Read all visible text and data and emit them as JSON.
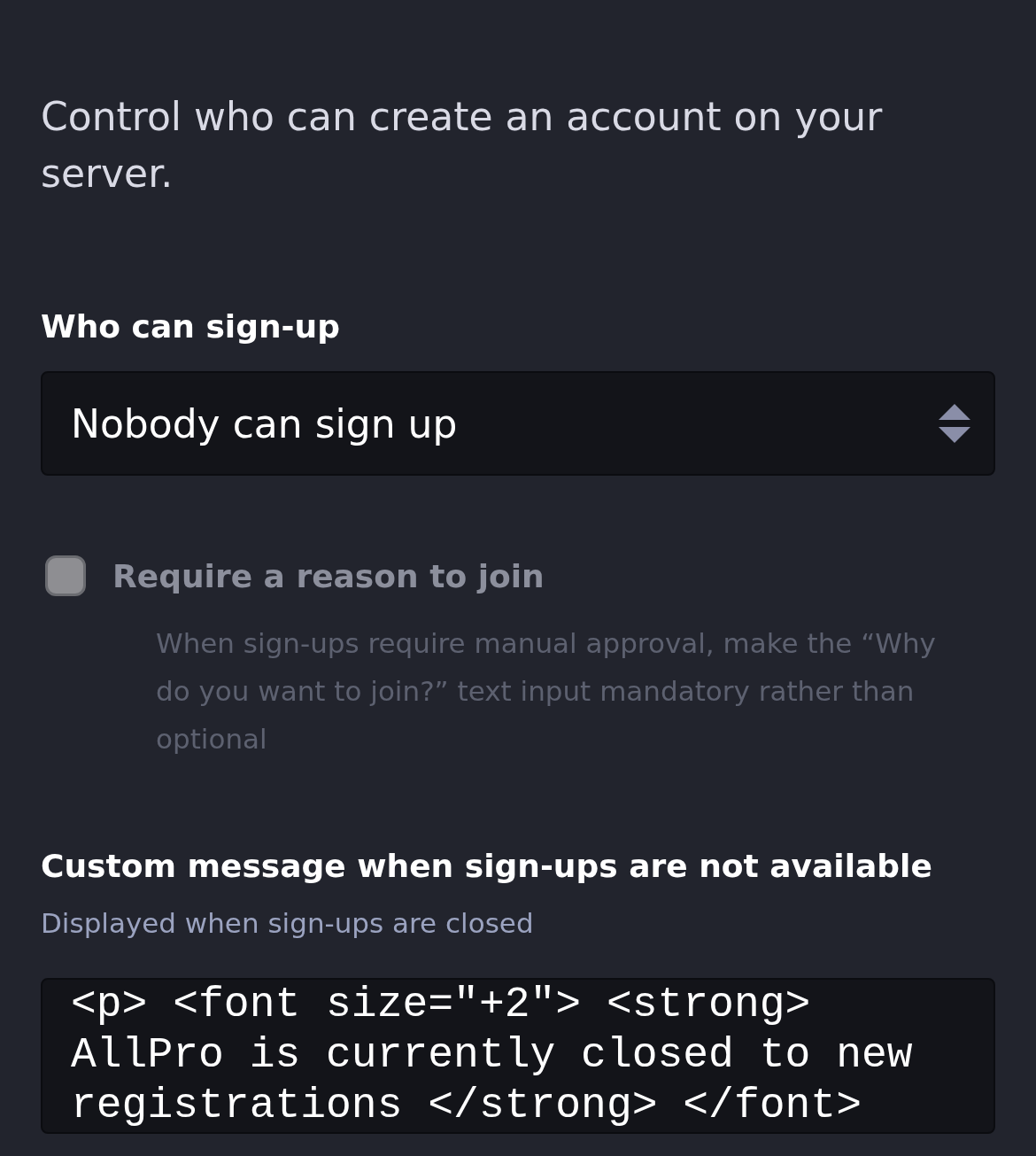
{
  "intro": "Control who can create an account on your server.",
  "signup": {
    "label": "Who can sign-up",
    "value": "Nobody can sign up"
  },
  "require_reason": {
    "label": "Require a reason to join",
    "hint": "When sign-ups require manual approval, make the “Why do you want to join?” text input mandatory rather than optional",
    "checked": false,
    "disabled": true
  },
  "closed_message": {
    "label": "Custom message when sign-ups are not available",
    "hint": "Displayed when sign-ups are closed",
    "value": "<p> <font size=\"+2\"> <strong> AllPro is currently closed to new registrations </strong> </font>"
  }
}
